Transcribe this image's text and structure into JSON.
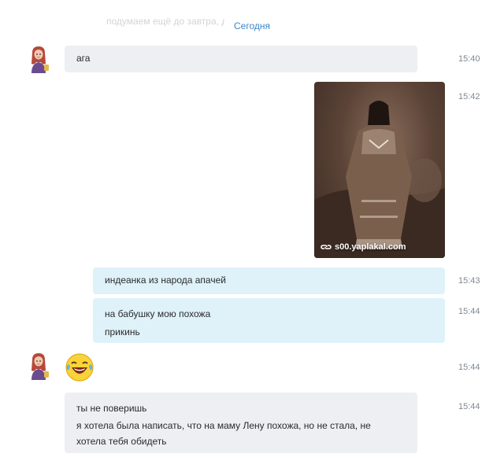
{
  "header": {
    "faded_prev_text": "подумаем ещё до завтра, да",
    "date_divider": "Сегодня"
  },
  "messages": [
    {
      "time": "15:40",
      "lines": [
        "ага"
      ]
    },
    {
      "time": "15:42",
      "caption": "s00.yaplakal.com"
    },
    {
      "time": "15:43",
      "lines": [
        "индеанка из народа апачей"
      ]
    },
    {
      "time": "15:44",
      "lines": [
        "на бабушку мою похожа",
        "прикинь"
      ]
    },
    {
      "time": "15:44",
      "emoji": "rolling-laughing-emoji"
    },
    {
      "time": "15:44",
      "lines": [
        "ты не поверишь",
        "я хотела была написать, что на маму Лену похожа, но не стала, не",
        "хотела тебя обидеть"
      ]
    }
  ],
  "colors": {
    "incoming_bubble": "#eeeff2",
    "outgoing_bubble": "#dff2fa",
    "date_accent": "#3d86c6",
    "timestamp": "#808891"
  }
}
